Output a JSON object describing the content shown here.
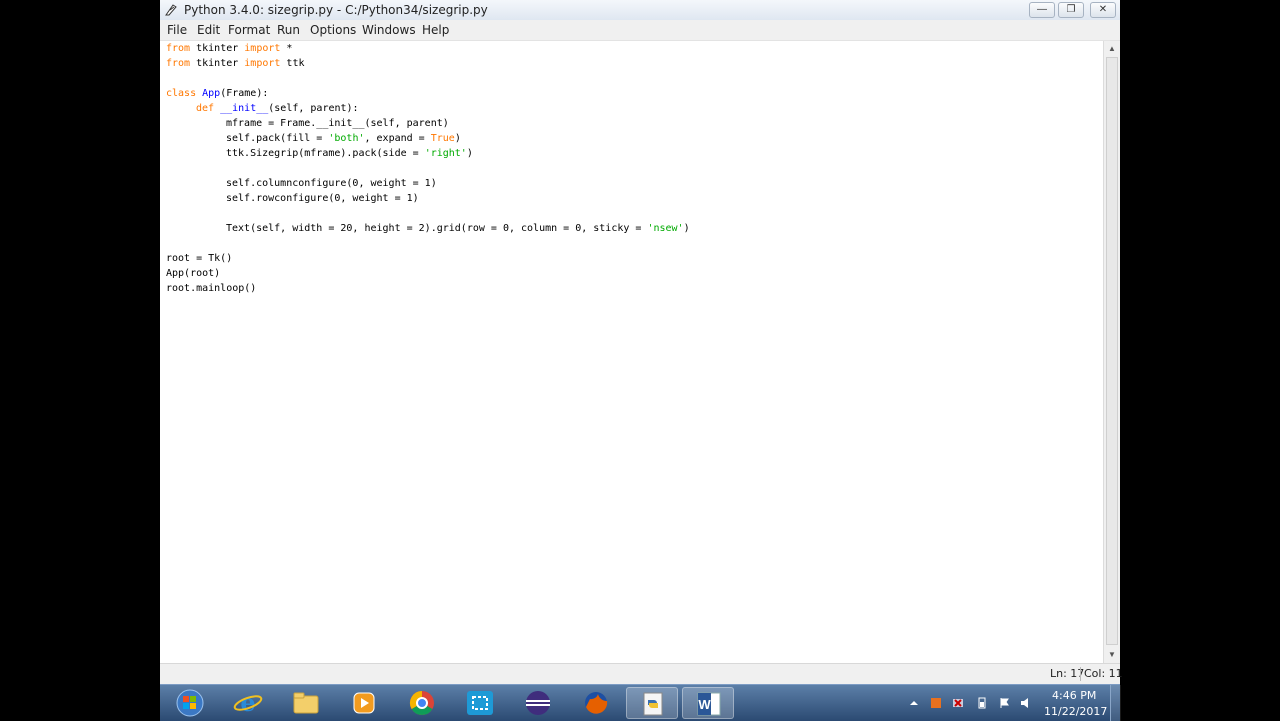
{
  "window": {
    "title": "Python 3.4.0: sizegrip.py - C:/Python34/sizegrip.py",
    "buttons": {
      "minimize": "—",
      "maximize": "❐",
      "close": "✕"
    }
  },
  "menu": [
    "File",
    "Edit",
    "Format",
    "Run",
    "Options",
    "Windows",
    "Help"
  ],
  "code": [
    {
      "indent": 0,
      "tokens": [
        {
          "t": "kw",
          "v": "from"
        },
        {
          "t": "n",
          "v": " tkinter "
        },
        {
          "t": "kw",
          "v": "import"
        },
        {
          "t": "n",
          "v": " *"
        }
      ]
    },
    {
      "indent": 0,
      "tokens": [
        {
          "t": "kw",
          "v": "from"
        },
        {
          "t": "n",
          "v": " tkinter "
        },
        {
          "t": "kw",
          "v": "import"
        },
        {
          "t": "n",
          "v": " ttk"
        }
      ]
    },
    {
      "indent": 0,
      "tokens": []
    },
    {
      "indent": 0,
      "tokens": [
        {
          "t": "kw",
          "v": "class"
        },
        {
          "t": "n",
          "v": " "
        },
        {
          "t": "def",
          "v": "App"
        },
        {
          "t": "n",
          "v": "(Frame):"
        }
      ]
    },
    {
      "indent": 4,
      "tokens": [
        {
          "t": "kw",
          "v": "def"
        },
        {
          "t": "n",
          "v": " "
        },
        {
          "t": "def",
          "v": "__init__"
        },
        {
          "t": "n",
          "v": "(self, parent):"
        }
      ]
    },
    {
      "indent": 8,
      "tokens": [
        {
          "t": "n",
          "v": "mframe = Frame.__init__(self, parent)"
        }
      ]
    },
    {
      "indent": 8,
      "tokens": [
        {
          "t": "n",
          "v": "self.pack(fill = "
        },
        {
          "t": "str",
          "v": "'both'"
        },
        {
          "t": "n",
          "v": ", expand = "
        },
        {
          "t": "kw",
          "v": "True"
        },
        {
          "t": "n",
          "v": ")"
        }
      ]
    },
    {
      "indent": 8,
      "tokens": [
        {
          "t": "n",
          "v": "ttk.Sizegrip(mframe).pack(side = "
        },
        {
          "t": "str",
          "v": "'right'"
        },
        {
          "t": "n",
          "v": ")"
        }
      ]
    },
    {
      "indent": 0,
      "tokens": []
    },
    {
      "indent": 8,
      "tokens": [
        {
          "t": "n",
          "v": "self.columnconfigure(0, weight = 1)"
        }
      ]
    },
    {
      "indent": 8,
      "tokens": [
        {
          "t": "n",
          "v": "self.rowconfigure(0, weight = 1)"
        }
      ]
    },
    {
      "indent": 0,
      "tokens": []
    },
    {
      "indent": 8,
      "tokens": [
        {
          "t": "n",
          "v": "Text(self, width = 20, height = 2).grid(row = 0, column = 0, sticky = "
        },
        {
          "t": "str",
          "v": "'nsew'"
        },
        {
          "t": "n",
          "v": ")"
        }
      ]
    },
    {
      "indent": 0,
      "tokens": []
    },
    {
      "indent": 0,
      "tokens": [
        {
          "t": "n",
          "v": "root = Tk()"
        }
      ]
    },
    {
      "indent": 0,
      "tokens": [
        {
          "t": "n",
          "v": "App(root)"
        }
      ]
    },
    {
      "indent": 0,
      "tokens": [
        {
          "t": "n",
          "v": "root.mainloop()"
        }
      ]
    }
  ],
  "status": {
    "line": "Ln: 17",
    "col": "Col: 11"
  },
  "taskbar": {
    "apps": [
      "start-orb",
      "internet-explorer",
      "file-explorer",
      "media-player",
      "chrome",
      "snipping-tool",
      "eclipse",
      "firefox",
      "python-idle",
      "word"
    ],
    "active_apps": [
      "python-idle",
      "word"
    ],
    "clock_time": "4:46 PM",
    "clock_date": "11/22/2017"
  },
  "colors": {
    "keyword": "#ff7700",
    "definition": "#0000ff",
    "string": "#00aa00"
  }
}
